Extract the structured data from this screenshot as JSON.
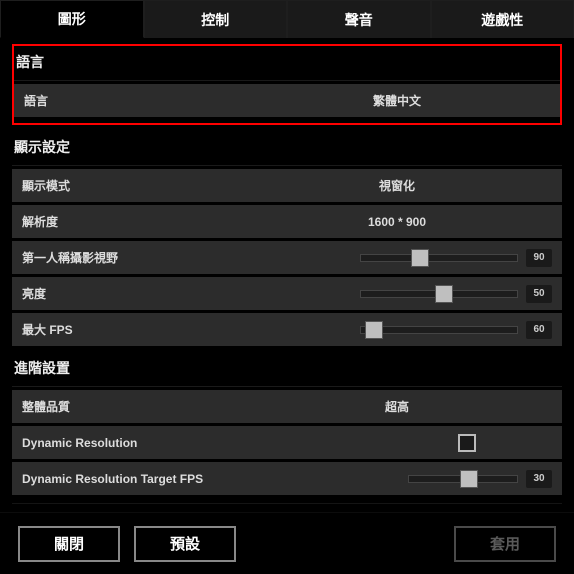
{
  "tabs": {
    "graphics": "圖形",
    "controls": "控制",
    "sound": "聲音",
    "gameplay": "遊戲性"
  },
  "sections": {
    "language": {
      "title": "語言",
      "rows": {
        "language": {
          "label": "語言",
          "value": "繁體中文"
        }
      }
    },
    "display": {
      "title": "顯示設定",
      "rows": {
        "mode": {
          "label": "顯示模式",
          "value": "視窗化"
        },
        "resolution": {
          "label": "解析度",
          "value": "1600 * 900"
        },
        "fov": {
          "label": "第一人稱攝影視野",
          "value": "90",
          "percent": 36
        },
        "brightness": {
          "label": "亮度",
          "value": "50",
          "percent": 53
        },
        "maxfps": {
          "label": "最大 FPS",
          "value": "60",
          "percent": 3
        }
      }
    },
    "advanced": {
      "title": "進階設置",
      "rows": {
        "quality": {
          "label": "整體品質",
          "value": "超高"
        },
        "dynres": {
          "label": "Dynamic Resolution",
          "checked": false
        },
        "dynresfps": {
          "label": "Dynamic Resolution Target FPS",
          "value": "30",
          "percent": 55
        }
      }
    }
  },
  "buttons": {
    "close": "關閉",
    "defaults": "預設",
    "apply": "套用"
  }
}
